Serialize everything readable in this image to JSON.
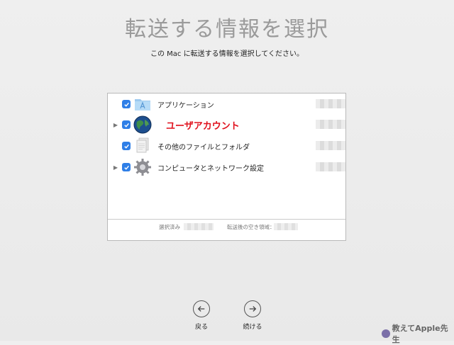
{
  "title": "転送する情報を選択",
  "subtitle": "この Mac に転送する情報を選択してください。",
  "items": [
    {
      "label": "アプリケーション",
      "icon": "applications-folder-icon",
      "checked": true,
      "expandable": false
    },
    {
      "label": "ユーザアカウント",
      "icon": "globe-user-icon",
      "checked": true,
      "expandable": true
    },
    {
      "label": "その他のファイルとフォルダ",
      "icon": "documents-icon",
      "checked": true,
      "expandable": false
    },
    {
      "label": "コンピュータとネットワーク設定",
      "icon": "gear-icon",
      "checked": true,
      "expandable": true
    }
  ],
  "footer": {
    "selected_label": "選択済み",
    "free_space_label": "転送後の空き領域："
  },
  "buttons": {
    "back_label": "戻る",
    "continue_label": "続ける"
  },
  "watermark": "教えてApple先生",
  "colors": {
    "checkbox": "#2f7fe7",
    "highlight_text": "#e0101c",
    "title_text": "#9a9a9a"
  }
}
